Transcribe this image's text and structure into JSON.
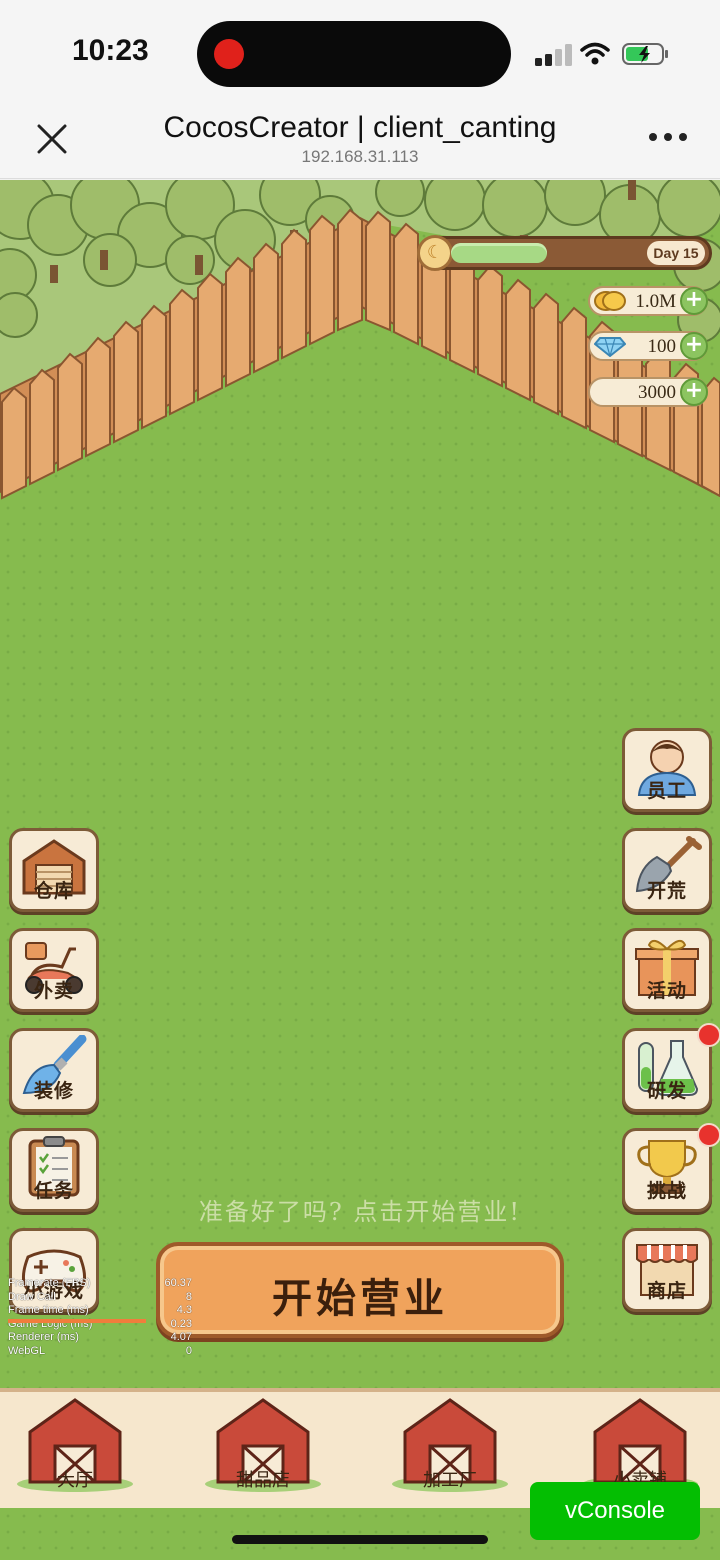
{
  "status_bar": {
    "time": "10:23"
  },
  "nav": {
    "title": "CocosCreator | client_canting",
    "subtitle": "192.168.31.113"
  },
  "hud": {
    "day_label": "Day 15",
    "day_progress": 0.5,
    "gold": "1.0M",
    "gems": "100",
    "third_resource": "3000"
  },
  "left_buttons": [
    {
      "label": "仓库",
      "icon": "warehouse-icon"
    },
    {
      "label": "外卖",
      "icon": "scooter-icon"
    },
    {
      "label": "装修",
      "icon": "paintbrush-icon"
    },
    {
      "label": "任务",
      "icon": "clipboard-icon"
    },
    {
      "label": "小游戏",
      "icon": "gamepad-icon"
    }
  ],
  "right_buttons": [
    {
      "label": "员工",
      "icon": "staff-icon"
    },
    {
      "label": "开荒",
      "icon": "shovel-icon"
    },
    {
      "label": "活动",
      "icon": "gift-icon"
    },
    {
      "label": "研发",
      "icon": "flask-icon"
    },
    {
      "label": "挑战",
      "icon": "trophy-icon"
    },
    {
      "label": "商店",
      "icon": "shop-icon"
    }
  ],
  "prompt": "准备好了吗? 点击开始营业!",
  "start_button": "开始营业",
  "bottom_tabs": [
    {
      "label": "大厅"
    },
    {
      "label": "甜品店"
    },
    {
      "label": "加工厂"
    },
    {
      "label": "小卖铺"
    }
  ],
  "debug": [
    {
      "name": "Framerate (FPS)",
      "value": "60.37"
    },
    {
      "name": "Draw Call",
      "value": "8"
    },
    {
      "name": "Frame time (ms)",
      "value": "4.3"
    },
    {
      "name": "Game Logic (ms)",
      "value": "0.23"
    },
    {
      "name": "Renderer (ms)",
      "value": "4.07"
    },
    {
      "name": "WebGL",
      "value": "0"
    }
  ],
  "vconsole_label": "vConsole",
  "colors": {
    "grass": "#86bb4e",
    "fence": "#e0a46a",
    "start_button": "#f0a35c",
    "vconsole": "#04be02"
  }
}
